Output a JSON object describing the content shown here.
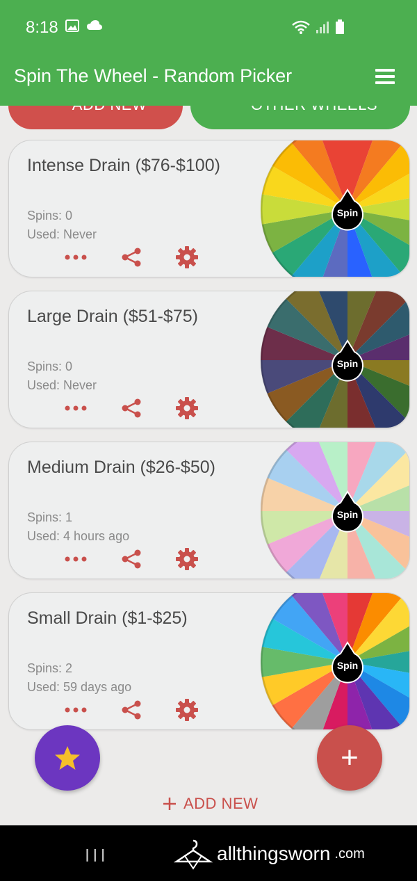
{
  "status_bar": {
    "time": "8:18"
  },
  "app_bar": {
    "title": "Spin The Wheel - Random Picker"
  },
  "top_buttons": {
    "add_new": "ADD NEW",
    "other_wheels": "OTHER WHEELS"
  },
  "cards": [
    {
      "title": "Intense Drain ($76-$100)",
      "spins": "Spins: 0",
      "used": "Used: Never"
    },
    {
      "title": "Large Drain ($51-$75)",
      "spins": "Spins: 0",
      "used": "Used: Never"
    },
    {
      "title": "Medium Drain ($26-$50)",
      "spins": "Spins: 1",
      "used": "Used: 4 hours ago"
    },
    {
      "title": "Small Drain ($1-$25)",
      "spins": "Spins: 2",
      "used": "Used: 59 days ago"
    }
  ],
  "spin_label": "Spin",
  "bottom": {
    "add_new": "ADD NEW",
    "plus_symbol": "+"
  },
  "watermark": {
    "text": "allthingsworn",
    "domain": ".com"
  },
  "nav": {
    "recent_symbol": "III"
  },
  "colors": {
    "app_green": "#4caf50",
    "accent_red": "#c9504c",
    "fab_purple": "#6c36c0",
    "star_yellow": "#f5c02a"
  }
}
